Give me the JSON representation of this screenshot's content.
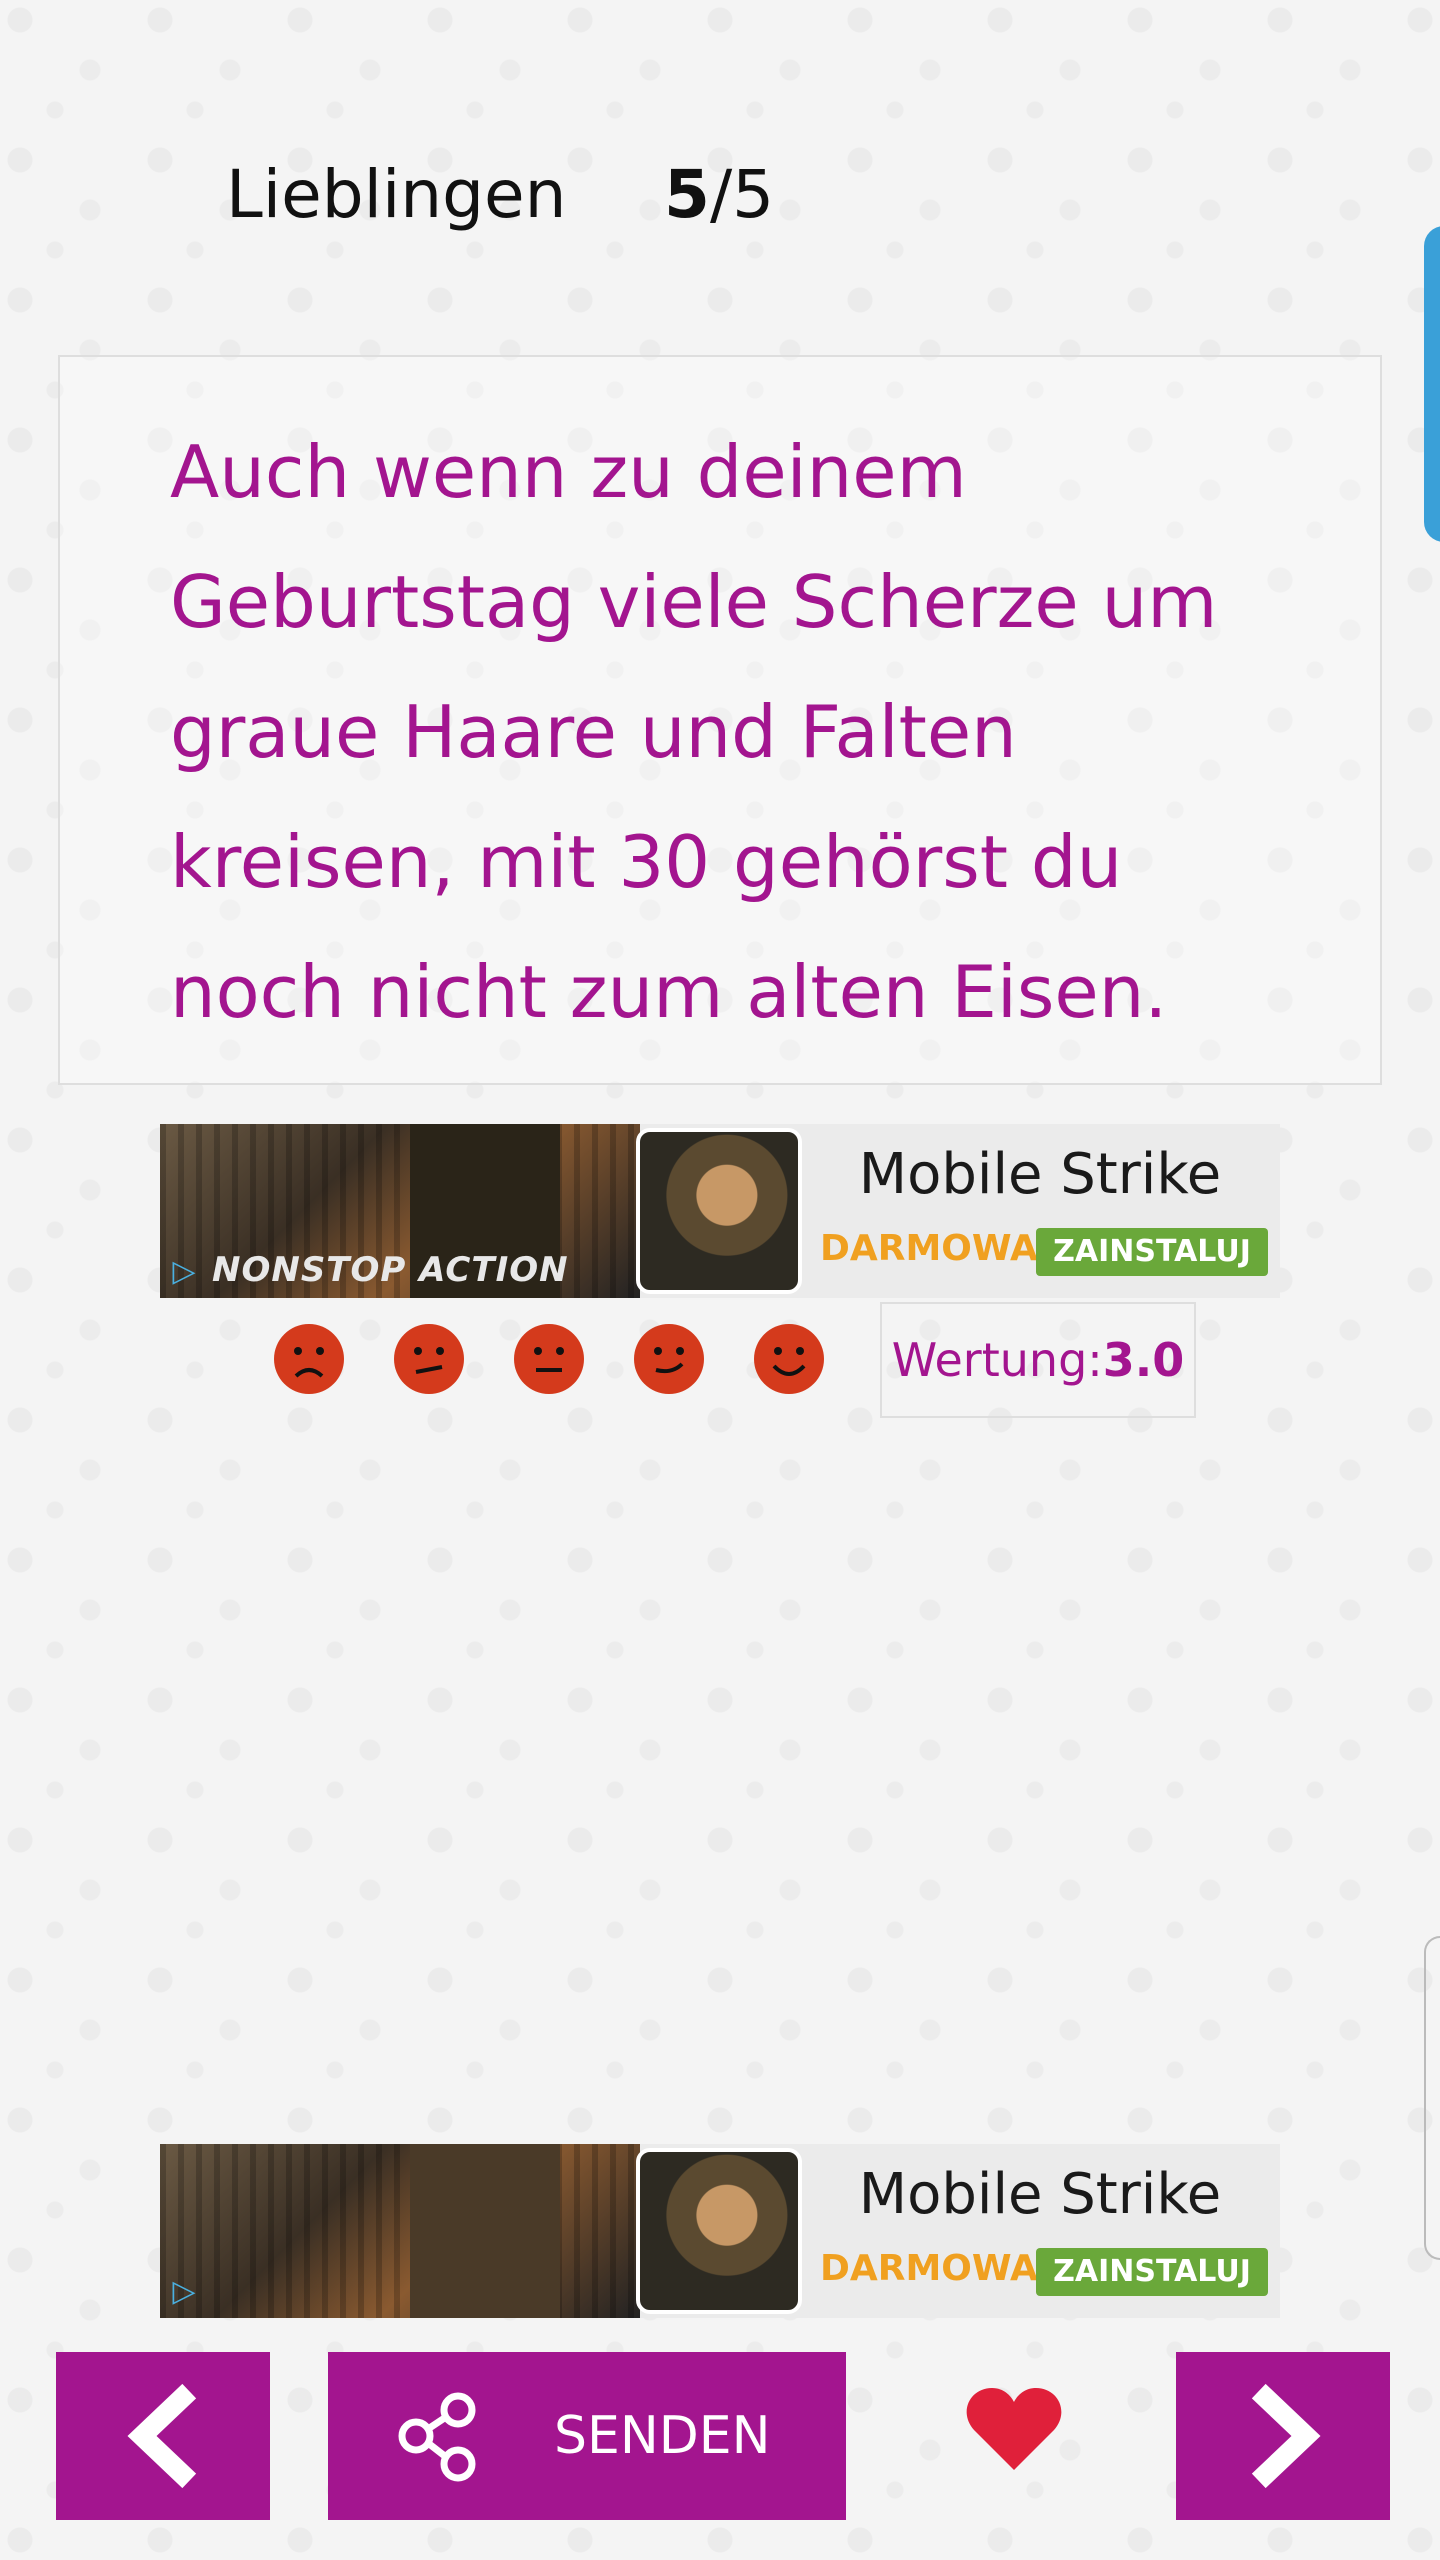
{
  "header": {
    "title": "Lieblingen",
    "current": "5",
    "total": "/5"
  },
  "quote": {
    "text": "Auch wenn zu deinem Geburtstag viele Scherze um graue Haare und Falten kreisen, mit 30 gehörst du noch nicht zum alten Eisen."
  },
  "ads": [
    {
      "image_text": "NONSTOP ACTION",
      "app_name": "Mobile Strike",
      "free_label": "DARMOWA",
      "install_label": "ZAINSTALUJ"
    },
    {
      "image_text": "",
      "app_name": "Mobile Strike",
      "free_label": "DARMOWA",
      "install_label": "ZAINSTALUJ"
    }
  ],
  "rating": {
    "label": "Wertung:",
    "value": "3.0",
    "faces": [
      "very-sad-face-icon",
      "sad-face-icon",
      "neutral-face-icon",
      "smile-face-icon",
      "happy-face-icon"
    ]
  },
  "nav": {
    "prev_icon": "chevron-left-icon",
    "send_label": "SENDEN",
    "share_icon": "share-icon",
    "favorite_icon": "heart-icon",
    "next_icon": "chevron-right-icon"
  },
  "colors": {
    "accent": "#a3158f",
    "smiley": "#d43a1c",
    "heart": "#e0203a",
    "install": "#6aa83a",
    "free": "#f0a020"
  }
}
